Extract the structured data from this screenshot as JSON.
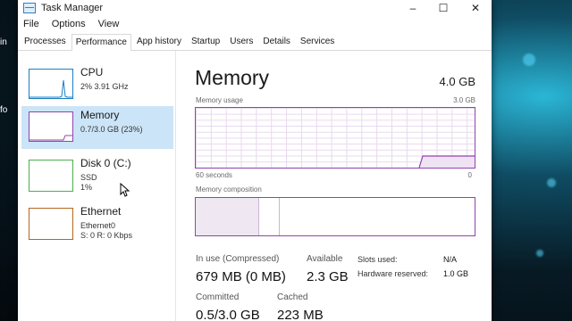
{
  "window": {
    "title": "Task Manager"
  },
  "menu": [
    "File",
    "Options",
    "View"
  ],
  "tabs": [
    {
      "label": "Processes"
    },
    {
      "label": "Performance"
    },
    {
      "label": "App history"
    },
    {
      "label": "Startup"
    },
    {
      "label": "Users"
    },
    {
      "label": "Details"
    },
    {
      "label": "Services"
    }
  ],
  "desktop_labels": [
    "in",
    "fo"
  ],
  "sidebar": [
    {
      "name": "CPU",
      "sub1": "2% 3.91 GHz",
      "sub2": "",
      "sub3": "",
      "color": "#1b7fc4"
    },
    {
      "name": "Memory",
      "sub1": "0.7/3.0 GB (23%)",
      "sub2": "",
      "sub3": "",
      "color": "#8e44ad"
    },
    {
      "name": "Disk 0 (C:)",
      "sub1": "SSD",
      "sub2": "1%",
      "sub3": "",
      "color": "#4caf50"
    },
    {
      "name": "Ethernet",
      "sub1": "Ethernet0",
      "sub2": "S: 0 R: 0 Kbps",
      "sub3": "",
      "color": "#b5651d"
    }
  ],
  "main": {
    "title": "Memory",
    "total": "4.0 GB",
    "usage_label": "Memory usage",
    "usage_max": "3.0 GB",
    "time_label": "60 seconds",
    "time_zero": "0",
    "composition_label": "Memory composition",
    "stats": {
      "in_use_label": "In use (Compressed)",
      "in_use_value": "679 MB (0 MB)",
      "available_label": "Available",
      "available_value": "2.3 GB",
      "committed_label": "Committed",
      "committed_value": "0.5/3.0 GB",
      "cached_label": "Cached",
      "cached_value": "223 MB",
      "slots_label": "Slots used:",
      "slots_value": "N/A",
      "hw_label": "Hardware reserved:",
      "hw_value": "1.0 GB"
    }
  },
  "colors": {
    "accent": "#8e44ad",
    "selected": "#cce4f7"
  }
}
